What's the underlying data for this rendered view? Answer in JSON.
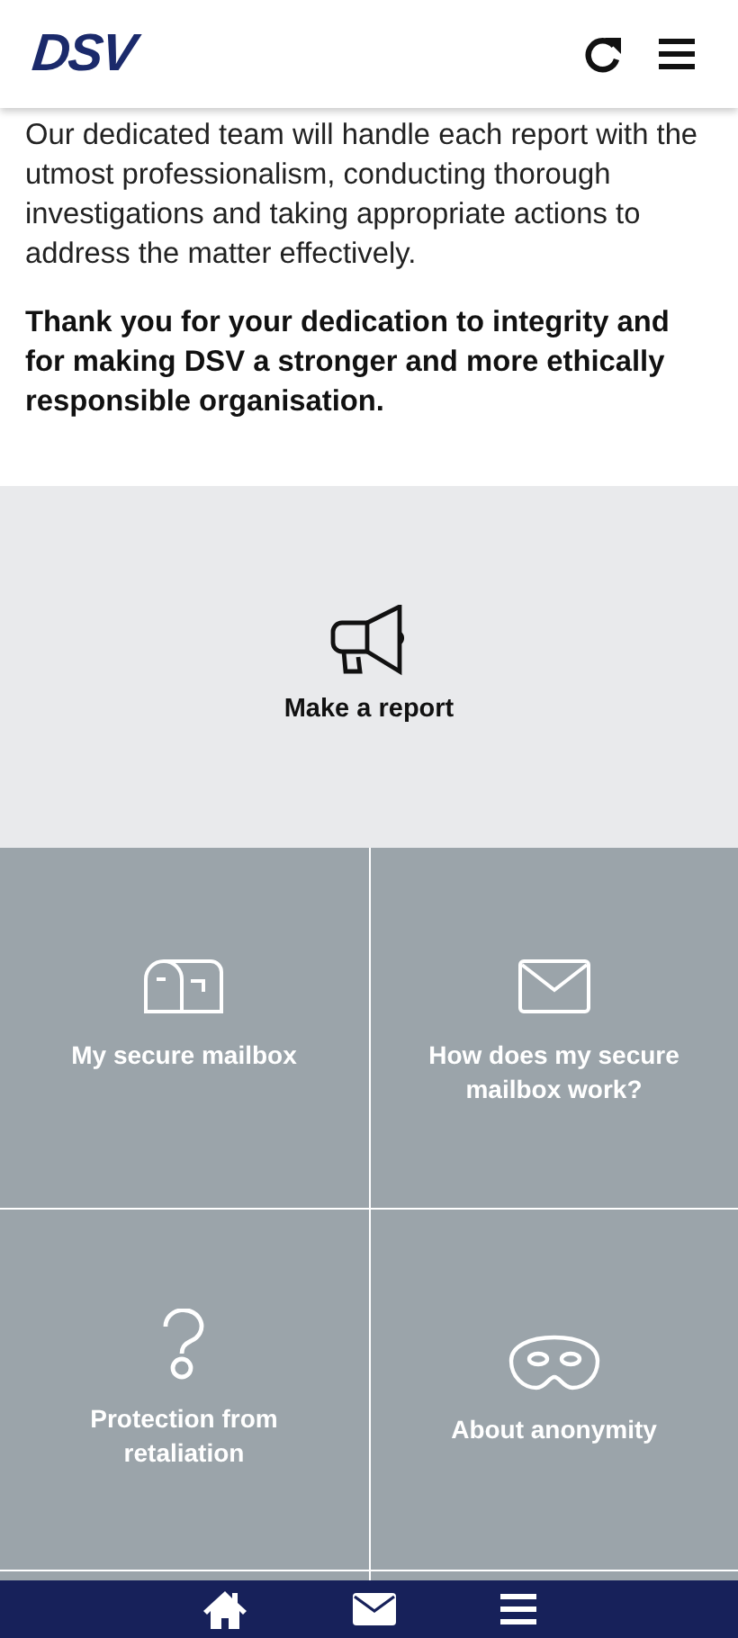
{
  "header": {
    "logo": "DSV"
  },
  "intro": {
    "text": "Our dedicated team will handle each report with the utmost professionalism, conducting thorough investigations and taking appropriate actions to address the matter effectively.",
    "closing": "Thank you for your dedication to integrity and for making DSV a stronger and more ethically responsible organisation."
  },
  "report": {
    "label": "Make a report"
  },
  "tiles": [
    {
      "kind": "mailbox",
      "label": "My secure mailbox"
    },
    {
      "kind": "envelope",
      "label": "How does my secure mailbox work?"
    },
    {
      "kind": "question",
      "label": "Protection from retaliation"
    },
    {
      "kind": "mask",
      "label": "About anonymity"
    }
  ],
  "bottom_nav": [
    {
      "kind": "home"
    },
    {
      "kind": "mail"
    },
    {
      "kind": "menu"
    }
  ]
}
